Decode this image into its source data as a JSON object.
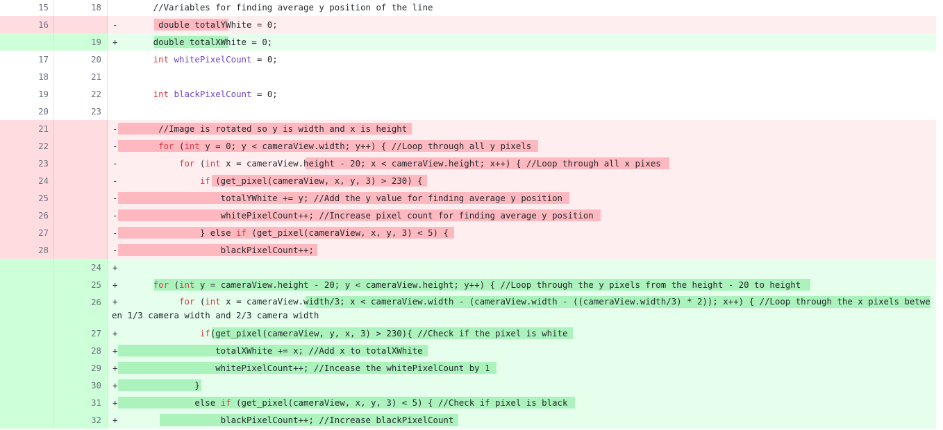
{
  "diff": {
    "rows": [
      {
        "type": "ctx",
        "old": "15",
        "new": "18",
        "marker": "",
        "text": "        //Variables for finding average y position of the line"
      },
      {
        "type": "del",
        "old": "16",
        "new": "",
        "marker": "-",
        "text": "         double totalYWhite = 0;"
      },
      {
        "type": "add",
        "old": "",
        "new": "19",
        "marker": "+",
        "text": "        double totalXWhite = 0;"
      },
      {
        "type": "ctx",
        "old": "17",
        "new": "20",
        "marker": "",
        "text": "        int whitePixelCount = 0;"
      },
      {
        "type": "ctx",
        "old": "18",
        "new": "21",
        "marker": "",
        "text": ""
      },
      {
        "type": "ctx",
        "old": "19",
        "new": "22",
        "marker": "",
        "text": "        int blackPixelCount = 0;"
      },
      {
        "type": "ctx",
        "old": "20",
        "new": "23",
        "marker": "",
        "text": ""
      },
      {
        "type": "del",
        "old": "21",
        "new": "",
        "marker": "-",
        "text": "         //Image is rotated so y is width and x is height"
      },
      {
        "type": "del",
        "old": "22",
        "new": "",
        "marker": "-",
        "text": "         for (int y = 0; y < cameraView.width; y++) { //Loop through all y pixels"
      },
      {
        "type": "del",
        "old": "23",
        "new": "",
        "marker": "-",
        "text": "             for (int x = cameraView.height - 20; x < cameraView.height; x++) { //Loop through all x pixes"
      },
      {
        "type": "del",
        "old": "24",
        "new": "",
        "marker": "-",
        "text": "                 if (get_pixel(cameraView, x, y, 3) > 230) {"
      },
      {
        "type": "del",
        "old": "25",
        "new": "",
        "marker": "-",
        "text": "                     totalYWhite += y; //Add the y value for finding average y position"
      },
      {
        "type": "del",
        "old": "26",
        "new": "",
        "marker": "-",
        "text": "                     whitePixelCount++; //Increase pixel count for finding average y position"
      },
      {
        "type": "del",
        "old": "27",
        "new": "",
        "marker": "-",
        "text": "                 } else if (get_pixel(cameraView, x, y, 3) < 5) {"
      },
      {
        "type": "del",
        "old": "28",
        "new": "",
        "marker": "-",
        "text": "                     blackPixelCount++;"
      },
      {
        "type": "add",
        "old": "",
        "new": "24",
        "marker": "+",
        "text": ""
      },
      {
        "type": "add",
        "old": "",
        "new": "25",
        "marker": "+",
        "text": "        for (int y = cameraView.height - 20; y < cameraView.height; y++) { //Loop through the y pixels from the height - 20 to height"
      },
      {
        "type": "add",
        "old": "",
        "new": "26",
        "marker": "+",
        "text": "             for (int x = cameraView.width/3; x < cameraView.width - (cameraView.width - ((cameraView.width/3) * 2)); x++) { //Loop through the x pixels between 1/3 camera width and 2/3 camera width"
      },
      {
        "type": "add",
        "old": "",
        "new": "27",
        "marker": "+",
        "text": "                 if(get_pixel(cameraView, y, x, 3) > 230){ //Check if the pixel is white"
      },
      {
        "type": "add",
        "old": "",
        "new": "28",
        "marker": "+",
        "text": "                    totalXWhite += x; //Add x to totalXWhite"
      },
      {
        "type": "add",
        "old": "",
        "new": "29",
        "marker": "+",
        "text": "                    whitePixelCount++; //Incease the whitePixelCount by 1"
      },
      {
        "type": "add",
        "old": "",
        "new": "30",
        "marker": "+",
        "text": "                }"
      },
      {
        "type": "add",
        "old": "",
        "new": "31",
        "marker": "+",
        "text": "                else if (get_pixel(cameraView, x, y, 3) < 5) { //Check if pixel is black"
      },
      {
        "type": "add",
        "old": "",
        "new": "32",
        "marker": "+",
        "text": "                     blackPixelCount++; //Increase blackPixelCount"
      }
    ]
  },
  "colors": {
    "deletion_bg": "#ffeef0",
    "deletion_gutter": "#ffdce0",
    "deletion_highlight": "#fdb8c0",
    "addition_bg": "#e6ffed",
    "addition_gutter": "#cdffd8",
    "addition_highlight": "#acf2bd",
    "keyword": "#d73a49",
    "identifier": "#6f42c1"
  }
}
